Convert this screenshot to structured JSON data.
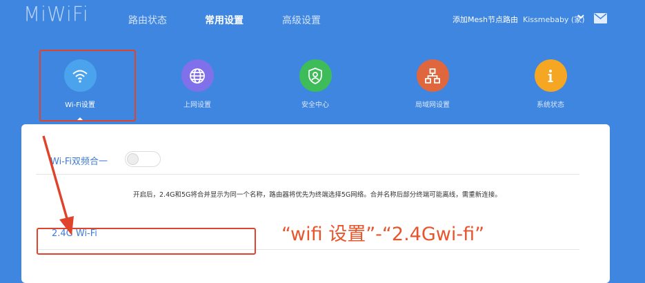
{
  "header": {
    "logo": "MiWiFi",
    "nav": [
      {
        "label": "路由状态",
        "active": false
      },
      {
        "label": "常用设置",
        "active": true
      },
      {
        "label": "高级设置",
        "active": false
      }
    ],
    "mesh_link": "添加Mesh节点路由",
    "user": "Kissmebaby (家)"
  },
  "tiles": [
    {
      "label": "Wi-Fi设置",
      "icon": "wifi-icon",
      "color": "#4aa3ec",
      "active": true
    },
    {
      "label": "上网设置",
      "icon": "globe-icon",
      "color": "#8070ea",
      "active": false
    },
    {
      "label": "安全中心",
      "icon": "shield-user-icon",
      "color": "#3ebc5a",
      "active": false
    },
    {
      "label": "局域网设置",
      "icon": "lan-icon",
      "color": "#e0673d",
      "active": false
    },
    {
      "label": "系统状态",
      "icon": "info-icon",
      "color": "#f5a623",
      "active": false
    }
  ],
  "panel": {
    "dual_band_label": "Wi-Fi双频合一",
    "dual_band_enabled": false,
    "description": "开启后，2.4G和5G将合并显示为同一个名称，路由器将优先为终端选择5G网络。合并名称后部分终端可能离线，需重新连接。",
    "section_24g": "2.4G Wi-Fi"
  },
  "annotation": {
    "text": "“wifi 设置”-“2.4Gwi-fi”",
    "color": "#e0432b"
  },
  "colors": {
    "background": "#3f86e0",
    "accent_text": "#3f7bd6"
  }
}
